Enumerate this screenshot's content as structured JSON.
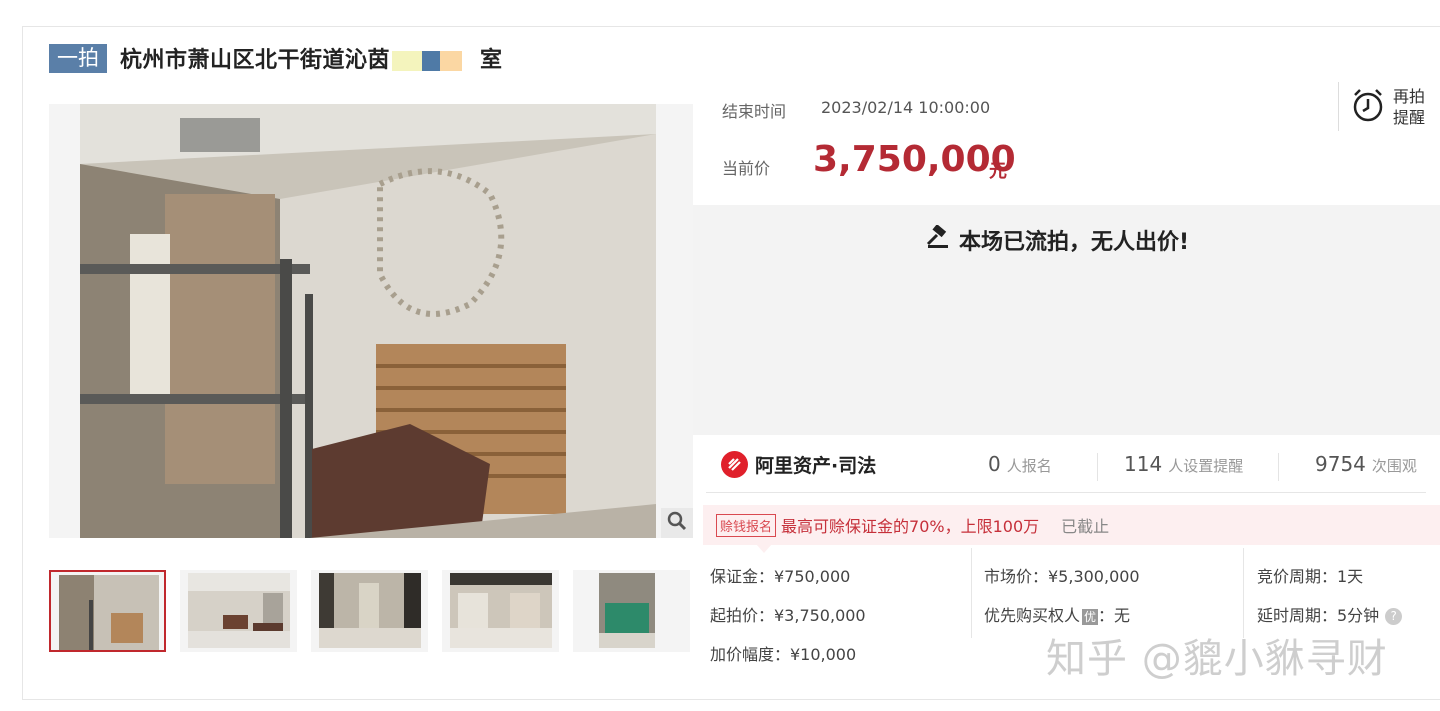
{
  "auction": {
    "round_badge": "一拍",
    "title_start": "杭州市萧山区北干街道沁茵",
    "title_end": "室"
  },
  "timing": {
    "end_label": "结束时间",
    "end_value": "2023/02/14 10:00:00"
  },
  "pricing": {
    "current_label": "当前价",
    "current_value": "3,750,000",
    "currency": "元"
  },
  "reminder": {
    "line1": "再拍",
    "line2": "提醒"
  },
  "status": {
    "message": "本场已流拍，无人出价!"
  },
  "platform": {
    "brand": "阿里资产·司法"
  },
  "stats": [
    {
      "value": "0",
      "label": "人报名"
    },
    {
      "value": "114",
      "label": "人设置提醒"
    },
    {
      "value": "9754",
      "label": "次围观"
    }
  ],
  "promo": {
    "tag": "赊钱报名",
    "text": "最高可赊保证金的70%，上限100万",
    "state": "已截止"
  },
  "details": {
    "deposit": "保证金：¥750,000",
    "start_price": "起拍价：¥3,750,000",
    "increment": "加价幅度：¥10,000",
    "market_price": "市场价：¥5,300,000",
    "priority_buyer_label": "优先购买权人",
    "priority_badge": "优",
    "priority_buyer_value": "：无",
    "bid_period": "竞价周期：1天",
    "delay_period": "延时周期：5分钟"
  },
  "watermark": "知乎 @貔小貅寻财",
  "colors": {
    "accent_red": "#b42a34",
    "badge_blue": "#5a7fa8",
    "thumb_active": "#c0282d"
  }
}
